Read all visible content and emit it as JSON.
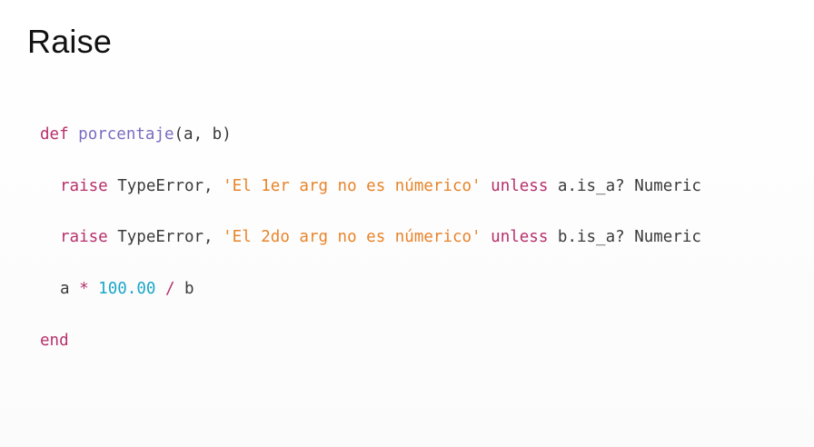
{
  "slide": {
    "title": "Raise"
  },
  "code": {
    "line1": {
      "kw_def": "def",
      "fn_name": "porcentaje",
      "params": "(a, b)"
    },
    "line2": {
      "kw_raise": "raise",
      "error": " TypeError, ",
      "message": "'El 1er arg no es númerico'",
      "kw_unless": "unless",
      "condition": " a.is_a? Numeric"
    },
    "line3": {
      "kw_raise": "raise",
      "error": " TypeError, ",
      "message": "'El 2do arg no es númerico'",
      "kw_unless": "unless",
      "condition": " b.is_a? Numeric"
    },
    "line4": {
      "var_a": "a ",
      "op_mul": "*",
      "number": "100.00",
      "op_div": "/",
      "var_b": " b"
    },
    "line5": {
      "kw_end": "end"
    }
  },
  "colors": {
    "keyword": "#b7306b",
    "function": "#7b6cc2",
    "string": "#e8842a",
    "number": "#1aa6c8",
    "text": "#3a3a3a"
  }
}
